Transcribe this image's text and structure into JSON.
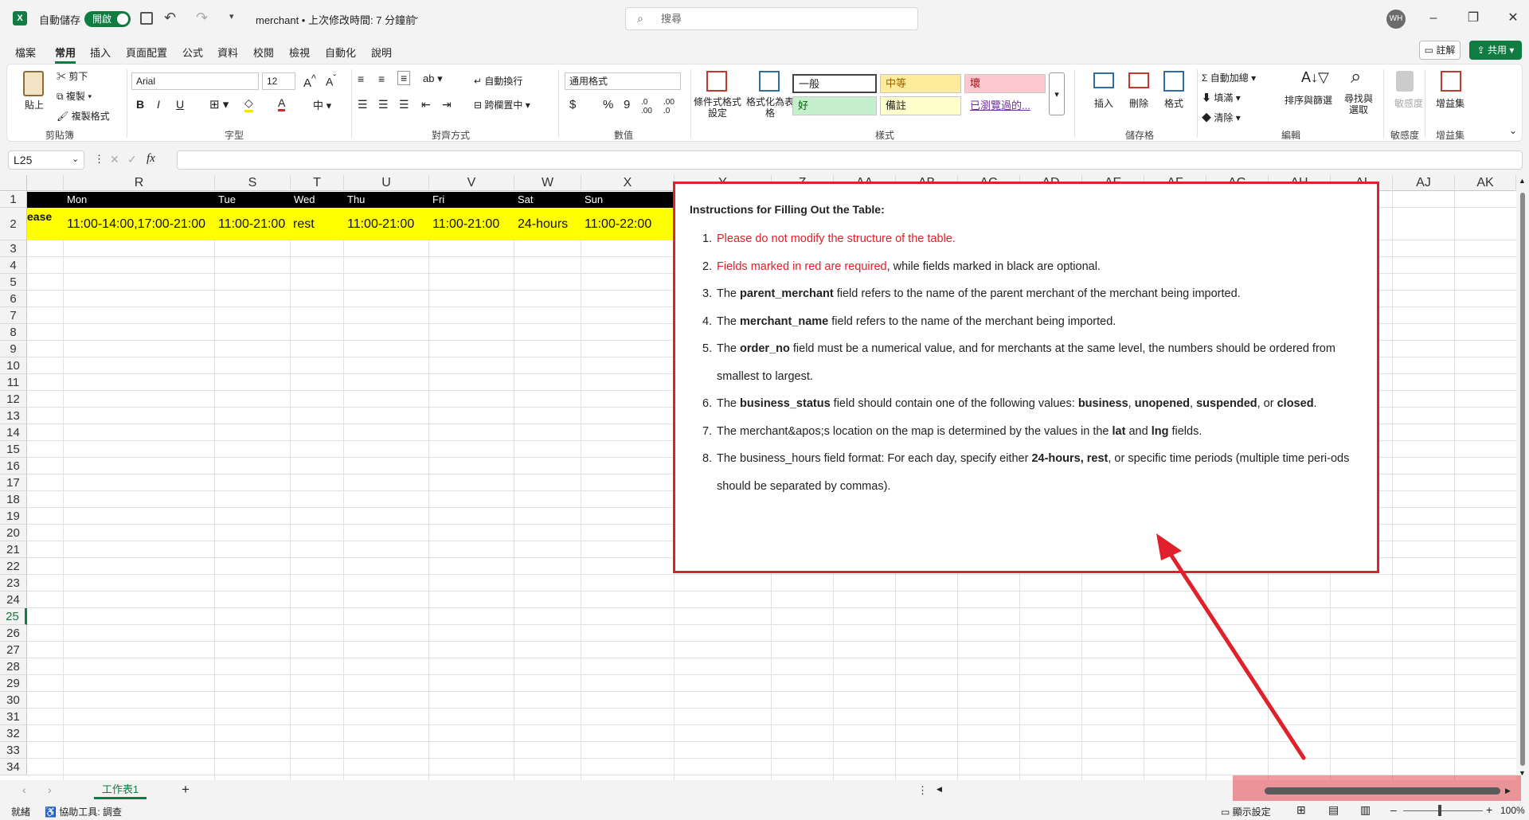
{
  "titlebar": {
    "autosave_label": "自動儲存",
    "autosave_state": "開啟",
    "file_title": "merchant • 上次修改時間: 7 分鐘前",
    "search_placeholder": "搜尋",
    "avatar_initials": "WH"
  },
  "menu": {
    "items": [
      "檔案",
      "常用",
      "插入",
      "頁面配置",
      "公式",
      "資料",
      "校閱",
      "檢視",
      "自動化",
      "說明"
    ],
    "active_index": 1,
    "comment_label": "註解",
    "share_label": "共用"
  },
  "ribbon": {
    "clipboard": {
      "paste": "貼上",
      "cut": "剪下",
      "copy": "複製",
      "format_painter": "複製格式",
      "label": "剪貼簿"
    },
    "font": {
      "name": "Arial",
      "size": "12",
      "label": "字型",
      "bold": "B",
      "italic": "I",
      "underline": "U"
    },
    "alignment": {
      "wrap": "自動換行",
      "merge": "跨欄置中",
      "label": "對齊方式"
    },
    "number": {
      "format": "通用格式",
      "currency": "$",
      "percent": "%",
      "comma": "9",
      "label": "數值"
    },
    "styles": {
      "conditional": "條件式格式設定",
      "as_table": "格式化為表格",
      "normal": "一般",
      "neutral": "中等",
      "bad": "壞",
      "good": "好",
      "note": "備註",
      "followed": "已瀏覽過的...",
      "label": "樣式"
    },
    "cells": {
      "insert": "插入",
      "delete": "刪除",
      "format": "格式",
      "label": "儲存格"
    },
    "editing": {
      "autosum": "自動加總",
      "fill": "填滿",
      "clear": "清除",
      "sort": "排序與篩選",
      "find": "尋找與選取",
      "label": "編輯"
    },
    "sensitivity": {
      "name": "敏感度",
      "label": "敏感度"
    },
    "addins": {
      "name": "增益集",
      "label": "增益集"
    }
  },
  "formulabar": {
    "name_box": "L25",
    "fx": "fx"
  },
  "grid": {
    "columns": [
      "R",
      "S",
      "T",
      "U",
      "V",
      "W",
      "X",
      "Y",
      "Z",
      "AA",
      "AB",
      "AC",
      "AD",
      "AE",
      "AF",
      "AG",
      "AH",
      "AI",
      "AJ",
      "AK"
    ],
    "rows": [
      "1",
      "2",
      "3",
      "4",
      "5",
      "6",
      "7",
      "8",
      "9",
      "10",
      "11",
      "12",
      "13",
      "14",
      "15",
      "16",
      "17",
      "18",
      "19",
      "20",
      "21",
      "22",
      "23",
      "24",
      "25",
      "26",
      "27",
      "28",
      "29",
      "30",
      "31",
      "32",
      "33",
      "34"
    ],
    "selected_row": "25",
    "row1": {
      "mon": "Mon",
      "tue": "Tue",
      "wed": "Wed",
      "thu": "Thu",
      "fri": "Fri",
      "sat": "Sat",
      "sun": "Sun"
    },
    "row2": {
      "clip": "ease",
      "mon": "11:00-14:00,17:00-21:00",
      "tue": "11:00-21:00",
      "wed": "rest",
      "thu": "11:00-21:00",
      "fri": "11:00-21:00",
      "sat": "24-hours",
      "sun": "11:00-22:00"
    }
  },
  "instructions": {
    "title": "Instructions for Filling Out the Table:",
    "items": [
      {
        "n": "1.",
        "red": "Please do not modify the structure of the table."
      },
      {
        "n": "2.",
        "red": "Fields marked in red are required",
        "rest": ", while fields marked in black are optional."
      },
      {
        "n": "3.",
        "a": "The ",
        "b": "parent_merchant",
        "c": " field refers to the name of the parent merchant of the merchant being imported."
      },
      {
        "n": "4.",
        "a": "The ",
        "b": "merchant_name",
        "c": " field refers to the name of the merchant being imported."
      },
      {
        "n": "5.",
        "a": "The ",
        "b": "order_no",
        "c": " field must be a numerical value, and for merchants at the same level, the numbers should be ordered from smallest to largest."
      },
      {
        "n": "6.",
        "a": "The ",
        "b": "business_status",
        "c": " field should contain one of the following values: ",
        "v1": "business",
        "s1": ", ",
        "v2": "unopened",
        "s2": ", ",
        "v3": "suspended",
        "s3": ", or ",
        "v4": "closed",
        "s4": "."
      },
      {
        "n": "7.",
        "a": "The merchant&apos;s location on the map is determined by the values in the ",
        "b": "lat",
        "c": " and ",
        "d": "lng",
        "e": " fields."
      },
      {
        "n": "8.",
        "a": "The business_hours field format: For each day, specify either ",
        "b": "24-hours, rest",
        "c": ", or specific time periods (multiple time peri-ods should be separated by commas)."
      }
    ]
  },
  "sheets": {
    "active": "工作表1",
    "add": "+"
  },
  "status": {
    "ready": "就緒",
    "accessibility": "協助工具: 調查",
    "display_settings": "顯示設定",
    "zoom": "100%"
  }
}
